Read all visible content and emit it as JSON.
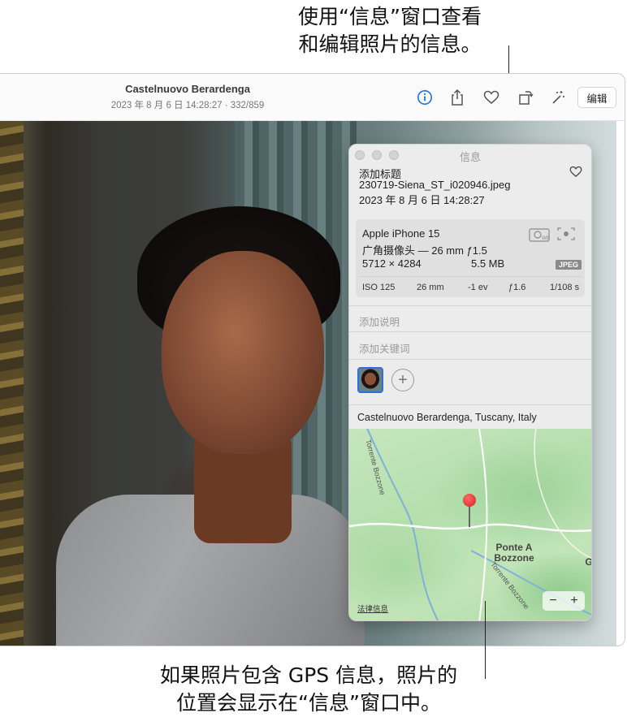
{
  "callouts": {
    "top_line1": "使用“信息”窗口查看",
    "top_line2": "和编辑照片的信息。",
    "bottom_line1": "如果照片包含 GPS 信息，照片的",
    "bottom_line2": "位置会显示在“信息”窗口中。"
  },
  "window": {
    "title": "Castelnuovo Berardenga",
    "subtitle": "2023 年 8 月 6 日 14:28:27 · 332/859",
    "edit_label": "编辑",
    "icons": [
      "info-icon",
      "share-icon",
      "heart-icon",
      "rotate-icon",
      "magic-wand-icon"
    ],
    "accent": "#1a73e8"
  },
  "info": {
    "title": "信息",
    "add_title_placeholder": "添加标题",
    "filename": "230719-Siena_ST_i020946.jpeg",
    "datetime": "2023 年 8 月 6 日  14:28:27",
    "camera": "Apple iPhone 15",
    "lens": "广角摄像头 — 26 mm ƒ1.5",
    "resolution": "5712 × 4284",
    "file_size": "5.5 MB",
    "format_badge": "JPEG",
    "exif": {
      "iso": "ISO 125",
      "focal": "26 mm",
      "ev": "-1 ev",
      "aperture": "ƒ1.6",
      "shutter": "1/108 s"
    },
    "caption_placeholder": "添加说明",
    "keywords_placeholder": "添加关键词",
    "add_person": "+",
    "location": "Castelnuovo Berardenga, Tuscany, Italy",
    "map": {
      "town_line1": "Ponte A",
      "town_line2": "Bozzone",
      "road1": "Torrente Bozzone",
      "road2": "Torrente Bozzone",
      "edge_letter": "G",
      "legal": "法律信息",
      "zoom_out": "−",
      "zoom_in": "+"
    }
  }
}
